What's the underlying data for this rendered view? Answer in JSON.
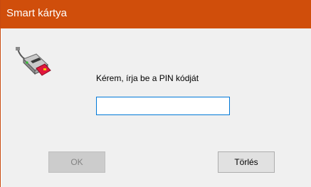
{
  "window": {
    "title": "Smart kártya"
  },
  "dialog": {
    "icon": "smart-card-reader-icon",
    "prompt": "Kérem, írja be a PIN kódját",
    "pin_value": "",
    "ok_label": "OK",
    "ok_enabled": false,
    "cancel_label": "Törlés"
  },
  "colors": {
    "title_bar": "#d04e0b",
    "client_background": "#f0f0f0",
    "input_focus_border": "#0078d7"
  }
}
